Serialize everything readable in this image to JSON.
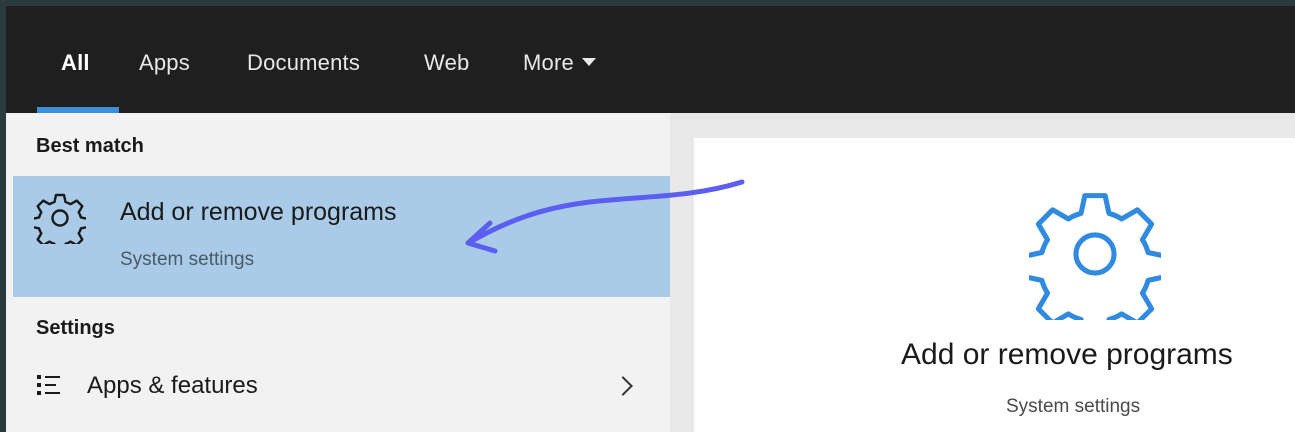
{
  "tabs": [
    {
      "label": "All",
      "active": true
    },
    {
      "label": "Apps"
    },
    {
      "label": "Documents"
    },
    {
      "label": "Web"
    },
    {
      "label": "More"
    }
  ],
  "left": {
    "best_match_heading": "Best match",
    "best_item": {
      "title": "Add or remove programs",
      "subtitle": "System settings",
      "icon": "gear-icon"
    },
    "settings_heading": "Settings",
    "settings_item": {
      "label": "Apps & features",
      "icon": "list-icon"
    }
  },
  "preview": {
    "title": "Add or remove programs",
    "subtitle": "System settings",
    "icon": "gear-icon"
  },
  "colors": {
    "accent": "#3b8fd8",
    "highlight": "#a9cbe8",
    "annotation_arrow": "#5b5ef0"
  }
}
